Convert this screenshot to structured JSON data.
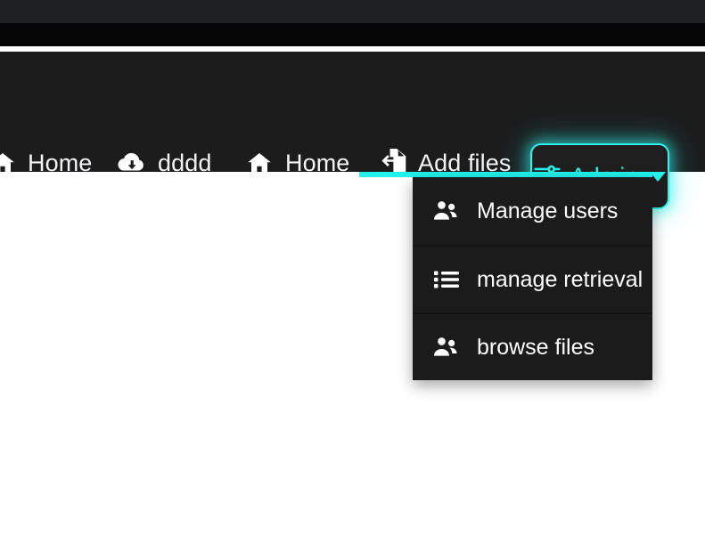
{
  "chrome": {
    "band_top_color": "#1e2024",
    "band_black_color": "#050505"
  },
  "navbar": {
    "background": "#1c1c1c",
    "text_color": "#f3f4f6",
    "items": [
      {
        "label": "Home",
        "icon": "home-icon"
      },
      {
        "label": "dddd",
        "icon": "cloud-download-icon"
      },
      {
        "label": "Home",
        "icon": "home-icon"
      },
      {
        "label": "Add files",
        "icon": "file-import-icon"
      }
    ],
    "admin": {
      "label": "Admin",
      "icon": "sliders-icon",
      "caret": "chevron-down-icon",
      "accent_color": "#25f4ee",
      "expanded": "true"
    }
  },
  "dropdown": {
    "accent_bar_color": "#22f2ec",
    "background": "#1b1b1b",
    "items": [
      {
        "label": "Manage users",
        "icon": "users-icon"
      },
      {
        "label": "manage retrieval",
        "icon": "list-ul-icon"
      },
      {
        "label": "browse files",
        "icon": "users-icon"
      }
    ]
  }
}
